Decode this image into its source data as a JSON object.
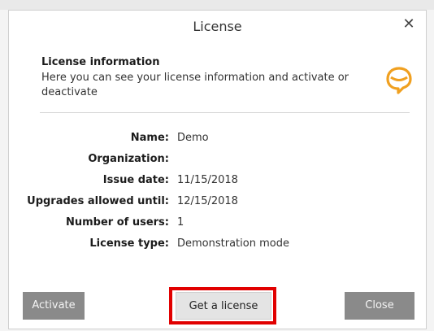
{
  "dialog": {
    "title": "License",
    "close_glyph": "✕"
  },
  "info": {
    "heading": "License information",
    "description": "Here you can see your license information and activate or deactivate",
    "logo_icon": "chat-bubble-logo",
    "logo_color": "#f0a020"
  },
  "fields": [
    {
      "label": "Name:",
      "value": "Demo"
    },
    {
      "label": "Organization:",
      "value": ""
    },
    {
      "label": "Issue date:",
      "value": "11/15/2018"
    },
    {
      "label": "Upgrades allowed until:",
      "value": "12/15/2018"
    },
    {
      "label": "Number of users:",
      "value": "1"
    },
    {
      "label": "License type:",
      "value": "Demonstration mode"
    }
  ],
  "buttons": {
    "activate": "Activate",
    "get_license": "Get a license",
    "close": "Close"
  },
  "colors": {
    "highlight": "#e10000",
    "button_gray": "#8a8a8a",
    "button_light": "#e4e4e4"
  }
}
